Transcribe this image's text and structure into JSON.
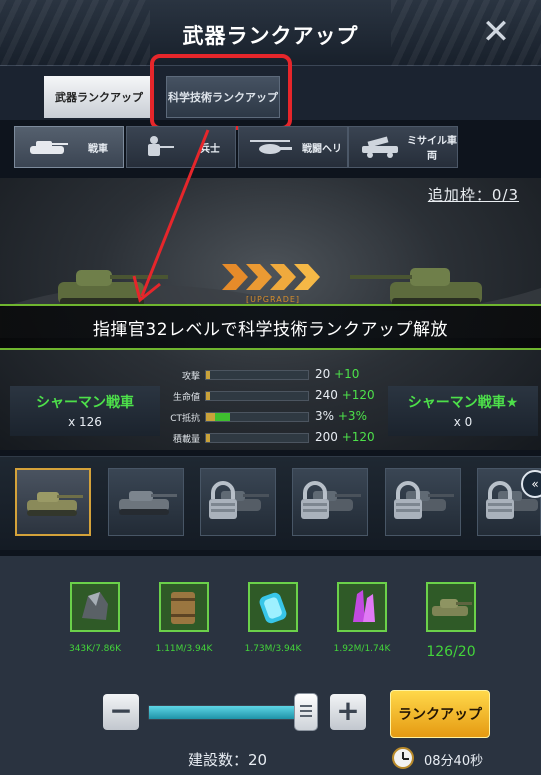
{
  "header": {
    "title": "武器ランクアップ"
  },
  "tabs": [
    {
      "label": "武器ランクアップ"
    },
    {
      "label": "科学技術ランクアップ"
    }
  ],
  "unit_tabs": [
    {
      "label": "戦車",
      "icon": "tank-icon"
    },
    {
      "label": "兵士",
      "icon": "soldier-icon"
    },
    {
      "label": "戦闘ヘリ",
      "icon": "helicopter-icon"
    },
    {
      "label": "ミサイル車両",
      "icon": "missile-vehicle-icon"
    }
  ],
  "scene": {
    "extra_slot": "追加枠：0/3",
    "upgrade_tag": "[UPGRADE]",
    "banner": "指揮官32レベルで科学技術ランクアップ解放"
  },
  "from_unit": {
    "name": "シャーマン戦車",
    "count": "x 126"
  },
  "to_unit": {
    "name": "シャーマン戦車★",
    "count": "x 0"
  },
  "stats": [
    {
      "label": "攻撃",
      "value": "20",
      "add": "+10",
      "base_pct": 0.04,
      "plus_pct": 0.0
    },
    {
      "label": "生命値",
      "value": "240",
      "add": "+120",
      "base_pct": 0.04,
      "plus_pct": 0.0
    },
    {
      "label": "CT抵抗",
      "value": "3%",
      "add": "+3%",
      "base_pct": 0.09,
      "plus_pct": 0.15
    },
    {
      "label": "積載量",
      "value": "200",
      "add": "+120",
      "base_pct": 0.04,
      "plus_pct": 0.0
    }
  ],
  "materials": [
    {
      "icon": "ore-icon",
      "value": "343K/7.86K"
    },
    {
      "icon": "fuel-barrel-icon",
      "value": "1.11M/3.94K"
    },
    {
      "icon": "energy-cell-icon",
      "value": "1.73M/3.94K"
    },
    {
      "icon": "crystal-icon",
      "value": "1.92M/1.74K"
    },
    {
      "icon": "tank-icon",
      "value": "126/20"
    }
  ],
  "controls": {
    "minus": "−",
    "plus": "+",
    "slider_fraction": 0.9,
    "rank_up_button": "ランクアップ",
    "build_count": "建設数：20",
    "timer": "08分40秒"
  },
  "colors": {
    "accent_green": "#4de04a",
    "highlight_red": "#e6262b",
    "button_gold": "#f2b426"
  }
}
